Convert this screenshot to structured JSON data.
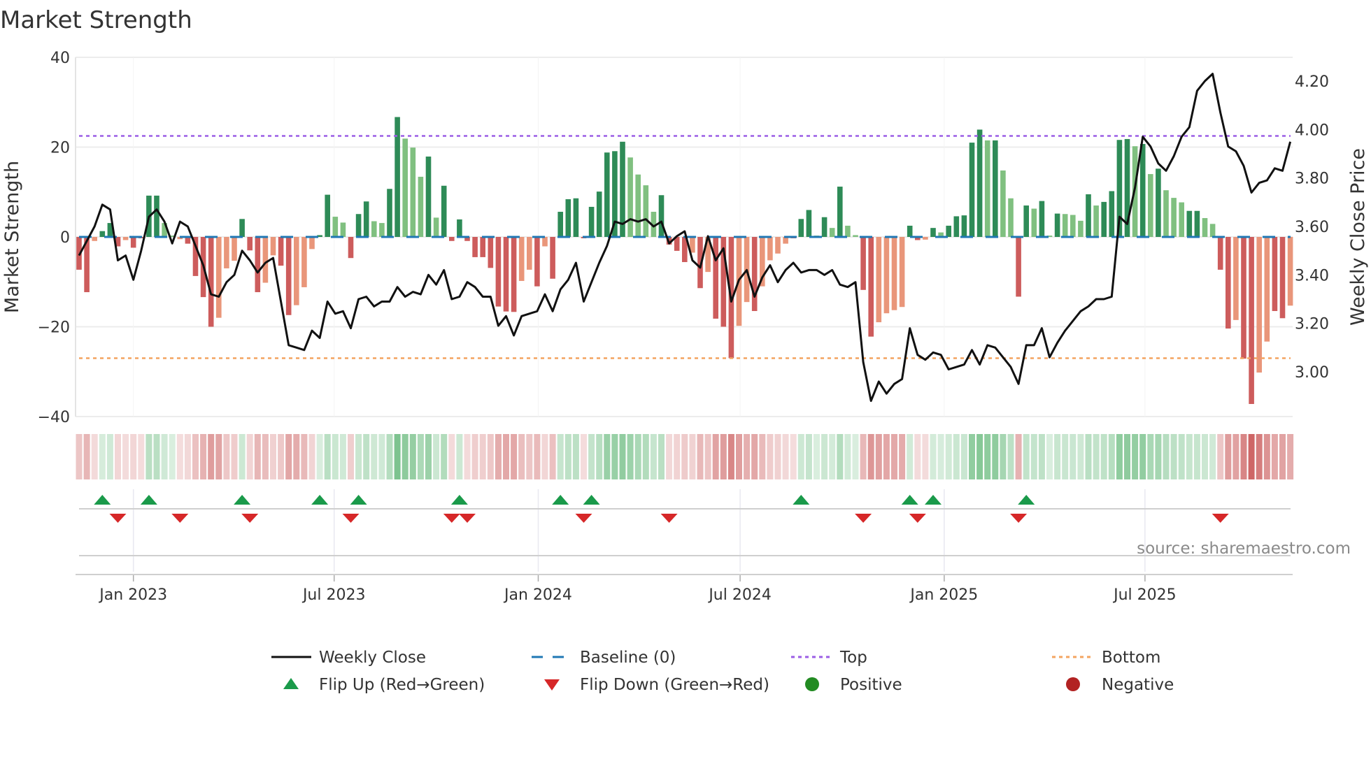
{
  "chart_data": {
    "type": "bar",
    "title": "Market Strength",
    "ylabel": "Market Strength",
    "y2label": "Weekly Close Price",
    "ylim": [
      -40,
      40
    ],
    "y2lim": [
      2.8,
      4.3
    ],
    "yticks": [
      "40",
      "20",
      "0",
      "−20",
      "−40"
    ],
    "ytick_values": [
      40,
      20,
      0,
      -20,
      -40
    ],
    "y2ticks": [
      "4.20",
      "4.00",
      "3.80",
      "3.60",
      "3.40",
      "3.20",
      "3.00"
    ],
    "y2tick_values": [
      4.2,
      4.0,
      3.8,
      3.6,
      3.4,
      3.2,
      3.0
    ],
    "first_week": "2022-11-13",
    "xticks": [
      {
        "label": "Jan 2023",
        "date": "2023-01-01"
      },
      {
        "label": "Jul 2023",
        "date": "2023-07-01"
      },
      {
        "label": "Jan 2024",
        "date": "2024-01-01"
      },
      {
        "label": "Jul 2024",
        "date": "2024-07-01"
      },
      {
        "label": "Jan 2025",
        "date": "2025-01-01"
      },
      {
        "label": "Jul 2025",
        "date": "2025-07-01"
      }
    ],
    "top_level": 22.5,
    "bottom_level": -27,
    "baseline": 0,
    "strength": [
      -7.3,
      -12.3,
      -0.9,
      1.3,
      3.1,
      -2.1,
      -0.7,
      -2.4,
      -0.3,
      9.2,
      9.2,
      3.1,
      0.3,
      -0.5,
      -1.5,
      -8.7,
      -13.4,
      -20,
      -18,
      -7,
      -5.3,
      4,
      -3,
      -12.3,
      -10.2,
      -4.1,
      -6.4,
      -17.4,
      -15.2,
      -11.2,
      -2.7,
      0.4,
      9.4,
      4.5,
      3.2,
      -4.7,
      5.1,
      7.9,
      3.5,
      3.1,
      10.7,
      26.7,
      21.9,
      19.9,
      13.4,
      17.9,
      4.3,
      11.4,
      -0.9,
      3.9,
      -0.9,
      -4.5,
      -4.5,
      -6.9,
      -15.5,
      -16.6,
      -16.7,
      -9.8,
      -7.3,
      -11,
      -2.1,
      -9.3,
      5.6,
      8.4,
      8.6,
      -0.3,
      6.7,
      10.1,
      18.8,
      19.1,
      21.2,
      17.7,
      13.9,
      11.5,
      5.6,
      9.3,
      -1.7,
      -3.1,
      -5.6,
      -3.5,
      -11.4,
      -7.8,
      -18.2,
      -20,
      -27,
      -19.8,
      -14.5,
      -16.5,
      -11,
      -5.2,
      -3.7,
      -1.5,
      -0.3,
      4,
      6,
      0.3,
      4.4,
      2,
      11.2,
      2.5,
      0.4,
      -11.8,
      -22.2,
      -19,
      -17,
      -16.3,
      -15.6,
      2.5,
      -0.7,
      -0.6,
      2,
      1,
      2.5,
      4.6,
      4.8,
      21,
      23.9,
      21.5,
      21.5,
      14.8,
      8.6,
      -13.3,
      7,
      6.3,
      8,
      0.3,
      5.2,
      5.1,
      4.9,
      3.6,
      9.5,
      7,
      7.8,
      10.2,
      21.6,
      21.8,
      20.2,
      20.7,
      14,
      15.2,
      10.4,
      8.7,
      7.7,
      5.8,
      5.8,
      4.2,
      2.9,
      -7.3,
      -20.4,
      -18.5,
      -27.1,
      -37.2,
      -30.2,
      -23.3,
      -16.5,
      -18.1,
      -15.3
    ],
    "strong": [
      1,
      1,
      0,
      1,
      1,
      1,
      0,
      1,
      1,
      1,
      1,
      0,
      0,
      0,
      1,
      1,
      1,
      1,
      0,
      0,
      0,
      1,
      1,
      1,
      0,
      0,
      1,
      1,
      0,
      0,
      0,
      1,
      1,
      0,
      0,
      1,
      1,
      1,
      0,
      0,
      1,
      1,
      0,
      0,
      0,
      1,
      0,
      1,
      1,
      1,
      1,
      1,
      1,
      1,
      1,
      1,
      1,
      0,
      0,
      1,
      0,
      1,
      1,
      1,
      1,
      1,
      1,
      1,
      1,
      1,
      1,
      0,
      0,
      0,
      0,
      1,
      1,
      1,
      1,
      0,
      1,
      0,
      1,
      1,
      1,
      0,
      0,
      1,
      0,
      0,
      0,
      0,
      1,
      1,
      1,
      0,
      1,
      0,
      1,
      0,
      0,
      1,
      1,
      0,
      0,
      0,
      0,
      1,
      1,
      0,
      1,
      0,
      1,
      1,
      1,
      1,
      1,
      0,
      1,
      0,
      0,
      1,
      1,
      0,
      1,
      0,
      1,
      0,
      0,
      0,
      1,
      0,
      1,
      1,
      1,
      1,
      0,
      1,
      0,
      1,
      0,
      0,
      0,
      1,
      1,
      0,
      0,
      1,
      1,
      0,
      1,
      1,
      0,
      0,
      1,
      1,
      0
    ],
    "weekly_close": [
      3.48,
      3.54,
      3.6,
      3.69,
      3.67,
      3.46,
      3.48,
      3.38,
      3.5,
      3.64,
      3.67,
      3.62,
      3.53,
      3.62,
      3.6,
      3.52,
      3.44,
      3.32,
      3.31,
      3.37,
      3.4,
      3.5,
      3.46,
      3.41,
      3.45,
      3.47,
      3.29,
      3.11,
      3.1,
      3.09,
      3.17,
      3.14,
      3.29,
      3.24,
      3.25,
      3.18,
      3.3,
      3.31,
      3.27,
      3.29,
      3.29,
      3.35,
      3.31,
      3.33,
      3.32,
      3.4,
      3.36,
      3.42,
      3.3,
      3.31,
      3.37,
      3.35,
      3.31,
      3.31,
      3.19,
      3.23,
      3.15,
      3.23,
      3.24,
      3.25,
      3.32,
      3.25,
      3.34,
      3.38,
      3.45,
      3.29,
      3.37,
      3.45,
      3.52,
      3.62,
      3.61,
      3.63,
      3.62,
      3.63,
      3.6,
      3.62,
      3.53,
      3.56,
      3.58,
      3.46,
      3.43,
      3.56,
      3.46,
      3.51,
      3.29,
      3.38,
      3.42,
      3.31,
      3.39,
      3.44,
      3.37,
      3.42,
      3.45,
      3.41,
      3.42,
      3.42,
      3.4,
      3.42,
      3.36,
      3.35,
      3.37,
      3.04,
      2.88,
      2.96,
      2.91,
      2.95,
      2.97,
      3.18,
      3.07,
      3.05,
      3.08,
      3.07,
      3.01,
      3.02,
      3.03,
      3.09,
      3.03,
      3.11,
      3.1,
      3.06,
      3.02,
      2.95,
      3.11,
      3.11,
      3.18,
      3.06,
      3.12,
      3.17,
      3.21,
      3.25,
      3.27,
      3.3,
      3.3,
      3.31,
      3.64,
      3.61,
      3.76,
      3.97,
      3.93,
      3.86,
      3.83,
      3.89,
      3.97,
      4.01,
      4.16,
      4.2,
      4.23,
      4.07,
      3.93,
      3.91,
      3.85,
      3.74,
      3.78,
      3.79,
      3.84,
      3.83,
      3.95
    ],
    "flip_up_weeks": [
      3,
      9,
      21,
      31,
      36,
      49,
      62,
      66,
      93,
      107,
      110,
      122
    ],
    "flip_down_weeks": [
      5,
      13,
      22,
      35,
      48,
      50,
      65,
      76,
      101,
      108,
      121,
      147
    ],
    "colors": {
      "strong_pos": "#2e8b57",
      "weak_pos": "#80c080",
      "strong_neg": "#cd5c5c",
      "weak_neg": "#e9967a",
      "line": "#111111",
      "baseline": "#1f77b4",
      "top": "#9b5de5",
      "bottom": "#f4a460",
      "flip_up": "#1a9a4a",
      "flip_down": "#d62728",
      "positive": "#228b22",
      "negative": "#b22222"
    },
    "legend": {
      "weekly_close": "Weekly Close",
      "baseline": "Baseline (0)",
      "top": "Top",
      "bottom": "Bottom",
      "flip_up": "Flip Up (Red→Green)",
      "flip_down": "Flip Down (Green→Red)",
      "positive": "Positive",
      "negative": "Negative"
    },
    "legend_placement": "bottom-center",
    "source": "source: sharemaestro.com"
  }
}
